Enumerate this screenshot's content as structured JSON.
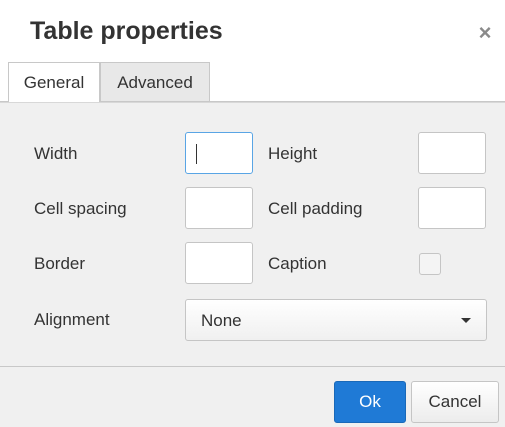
{
  "dialog": {
    "title": "Table properties",
    "close_glyph": "×"
  },
  "tabs": [
    {
      "label": "General",
      "active": true
    },
    {
      "label": "Advanced",
      "active": false
    }
  ],
  "form": {
    "width_label": "Width",
    "width_value": "",
    "height_label": "Height",
    "height_value": "",
    "cell_spacing_label": "Cell spacing",
    "cell_spacing_value": "",
    "cell_padding_label": "Cell padding",
    "cell_padding_value": "",
    "border_label": "Border",
    "border_value": "",
    "caption_label": "Caption",
    "caption_checked": false,
    "alignment_label": "Alignment",
    "alignment_value": "None"
  },
  "footer": {
    "ok_label": "Ok",
    "cancel_label": "Cancel"
  },
  "colors": {
    "primary_button": "#1f7ad6",
    "panel_background": "#f0f0f0",
    "focus_border": "#59a5e5"
  },
  "icons": {
    "close": "close-icon",
    "dropdown": "chevron-down-icon"
  }
}
